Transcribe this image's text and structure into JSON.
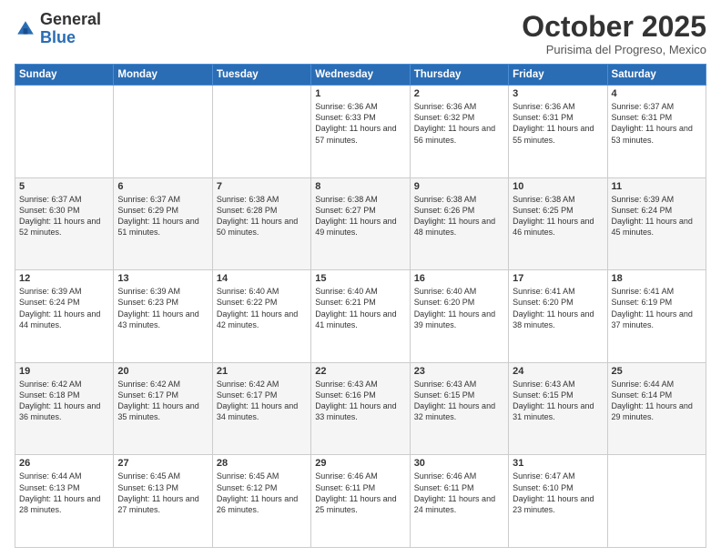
{
  "logo": {
    "general": "General",
    "blue": "Blue"
  },
  "header": {
    "month": "October 2025",
    "location": "Purisima del Progreso, Mexico"
  },
  "days_of_week": [
    "Sunday",
    "Monday",
    "Tuesday",
    "Wednesday",
    "Thursday",
    "Friday",
    "Saturday"
  ],
  "weeks": [
    [
      {
        "day": "",
        "sunrise": "",
        "sunset": "",
        "daylight": ""
      },
      {
        "day": "",
        "sunrise": "",
        "sunset": "",
        "daylight": ""
      },
      {
        "day": "",
        "sunrise": "",
        "sunset": "",
        "daylight": ""
      },
      {
        "day": "1",
        "sunrise": "Sunrise: 6:36 AM",
        "sunset": "Sunset: 6:33 PM",
        "daylight": "Daylight: 11 hours and 57 minutes."
      },
      {
        "day": "2",
        "sunrise": "Sunrise: 6:36 AM",
        "sunset": "Sunset: 6:32 PM",
        "daylight": "Daylight: 11 hours and 56 minutes."
      },
      {
        "day": "3",
        "sunrise": "Sunrise: 6:36 AM",
        "sunset": "Sunset: 6:31 PM",
        "daylight": "Daylight: 11 hours and 55 minutes."
      },
      {
        "day": "4",
        "sunrise": "Sunrise: 6:37 AM",
        "sunset": "Sunset: 6:31 PM",
        "daylight": "Daylight: 11 hours and 53 minutes."
      }
    ],
    [
      {
        "day": "5",
        "sunrise": "Sunrise: 6:37 AM",
        "sunset": "Sunset: 6:30 PM",
        "daylight": "Daylight: 11 hours and 52 minutes."
      },
      {
        "day": "6",
        "sunrise": "Sunrise: 6:37 AM",
        "sunset": "Sunset: 6:29 PM",
        "daylight": "Daylight: 11 hours and 51 minutes."
      },
      {
        "day": "7",
        "sunrise": "Sunrise: 6:38 AM",
        "sunset": "Sunset: 6:28 PM",
        "daylight": "Daylight: 11 hours and 50 minutes."
      },
      {
        "day": "8",
        "sunrise": "Sunrise: 6:38 AM",
        "sunset": "Sunset: 6:27 PM",
        "daylight": "Daylight: 11 hours and 49 minutes."
      },
      {
        "day": "9",
        "sunrise": "Sunrise: 6:38 AM",
        "sunset": "Sunset: 6:26 PM",
        "daylight": "Daylight: 11 hours and 48 minutes."
      },
      {
        "day": "10",
        "sunrise": "Sunrise: 6:38 AM",
        "sunset": "Sunset: 6:25 PM",
        "daylight": "Daylight: 11 hours and 46 minutes."
      },
      {
        "day": "11",
        "sunrise": "Sunrise: 6:39 AM",
        "sunset": "Sunset: 6:24 PM",
        "daylight": "Daylight: 11 hours and 45 minutes."
      }
    ],
    [
      {
        "day": "12",
        "sunrise": "Sunrise: 6:39 AM",
        "sunset": "Sunset: 6:24 PM",
        "daylight": "Daylight: 11 hours and 44 minutes."
      },
      {
        "day": "13",
        "sunrise": "Sunrise: 6:39 AM",
        "sunset": "Sunset: 6:23 PM",
        "daylight": "Daylight: 11 hours and 43 minutes."
      },
      {
        "day": "14",
        "sunrise": "Sunrise: 6:40 AM",
        "sunset": "Sunset: 6:22 PM",
        "daylight": "Daylight: 11 hours and 42 minutes."
      },
      {
        "day": "15",
        "sunrise": "Sunrise: 6:40 AM",
        "sunset": "Sunset: 6:21 PM",
        "daylight": "Daylight: 11 hours and 41 minutes."
      },
      {
        "day": "16",
        "sunrise": "Sunrise: 6:40 AM",
        "sunset": "Sunset: 6:20 PM",
        "daylight": "Daylight: 11 hours and 39 minutes."
      },
      {
        "day": "17",
        "sunrise": "Sunrise: 6:41 AM",
        "sunset": "Sunset: 6:20 PM",
        "daylight": "Daylight: 11 hours and 38 minutes."
      },
      {
        "day": "18",
        "sunrise": "Sunrise: 6:41 AM",
        "sunset": "Sunset: 6:19 PM",
        "daylight": "Daylight: 11 hours and 37 minutes."
      }
    ],
    [
      {
        "day": "19",
        "sunrise": "Sunrise: 6:42 AM",
        "sunset": "Sunset: 6:18 PM",
        "daylight": "Daylight: 11 hours and 36 minutes."
      },
      {
        "day": "20",
        "sunrise": "Sunrise: 6:42 AM",
        "sunset": "Sunset: 6:17 PM",
        "daylight": "Daylight: 11 hours and 35 minutes."
      },
      {
        "day": "21",
        "sunrise": "Sunrise: 6:42 AM",
        "sunset": "Sunset: 6:17 PM",
        "daylight": "Daylight: 11 hours and 34 minutes."
      },
      {
        "day": "22",
        "sunrise": "Sunrise: 6:43 AM",
        "sunset": "Sunset: 6:16 PM",
        "daylight": "Daylight: 11 hours and 33 minutes."
      },
      {
        "day": "23",
        "sunrise": "Sunrise: 6:43 AM",
        "sunset": "Sunset: 6:15 PM",
        "daylight": "Daylight: 11 hours and 32 minutes."
      },
      {
        "day": "24",
        "sunrise": "Sunrise: 6:43 AM",
        "sunset": "Sunset: 6:15 PM",
        "daylight": "Daylight: 11 hours and 31 minutes."
      },
      {
        "day": "25",
        "sunrise": "Sunrise: 6:44 AM",
        "sunset": "Sunset: 6:14 PM",
        "daylight": "Daylight: 11 hours and 29 minutes."
      }
    ],
    [
      {
        "day": "26",
        "sunrise": "Sunrise: 6:44 AM",
        "sunset": "Sunset: 6:13 PM",
        "daylight": "Daylight: 11 hours and 28 minutes."
      },
      {
        "day": "27",
        "sunrise": "Sunrise: 6:45 AM",
        "sunset": "Sunset: 6:13 PM",
        "daylight": "Daylight: 11 hours and 27 minutes."
      },
      {
        "day": "28",
        "sunrise": "Sunrise: 6:45 AM",
        "sunset": "Sunset: 6:12 PM",
        "daylight": "Daylight: 11 hours and 26 minutes."
      },
      {
        "day": "29",
        "sunrise": "Sunrise: 6:46 AM",
        "sunset": "Sunset: 6:11 PM",
        "daylight": "Daylight: 11 hours and 25 minutes."
      },
      {
        "day": "30",
        "sunrise": "Sunrise: 6:46 AM",
        "sunset": "Sunset: 6:11 PM",
        "daylight": "Daylight: 11 hours and 24 minutes."
      },
      {
        "day": "31",
        "sunrise": "Sunrise: 6:47 AM",
        "sunset": "Sunset: 6:10 PM",
        "daylight": "Daylight: 11 hours and 23 minutes."
      },
      {
        "day": "",
        "sunrise": "",
        "sunset": "",
        "daylight": ""
      }
    ]
  ]
}
